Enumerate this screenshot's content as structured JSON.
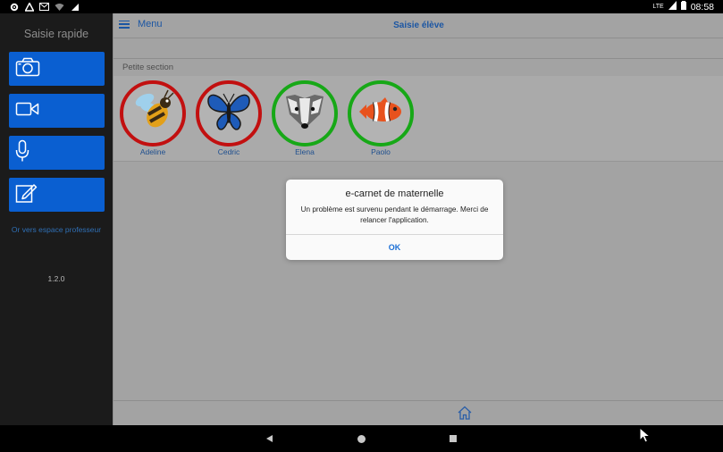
{
  "status_bar": {
    "time": "08:58",
    "network": "LTE",
    "left_icons": [
      "gear-icon",
      "recycle-icon",
      "mail-icon",
      "wifi-icon",
      "signal-icon"
    ]
  },
  "sidebar": {
    "title": "Saisie rapide",
    "buttons": [
      {
        "icon": "camera-icon"
      },
      {
        "icon": "video-icon"
      },
      {
        "icon": "microphone-icon"
      },
      {
        "icon": "edit-icon"
      }
    ],
    "teacher_link": "Or vers espace professeur",
    "version": "1.2.0"
  },
  "header": {
    "menu_label": "Menu",
    "title": "Saisie élève"
  },
  "section": {
    "label": "Petite section"
  },
  "students": [
    {
      "name": "Adeline",
      "animal": "bee-icon",
      "ring_color": "#c21010"
    },
    {
      "name": "Cedric",
      "animal": "butterfly-icon",
      "ring_color": "#c21010"
    },
    {
      "name": "Elena",
      "animal": "badger-icon",
      "ring_color": "#17a817"
    },
    {
      "name": "Paolo",
      "animal": "clownfish-icon",
      "ring_color": "#17a817"
    }
  ],
  "dialog": {
    "title": "e-carnet de maternelle",
    "message": "Un problème est survenu pendant le démarrage. Merci de relancer l'application.",
    "ok_label": "OK"
  },
  "colors": {
    "accent": "#0a5fd1",
    "link": "#1b56a3",
    "dialog_ok": "#1b6fd6"
  }
}
